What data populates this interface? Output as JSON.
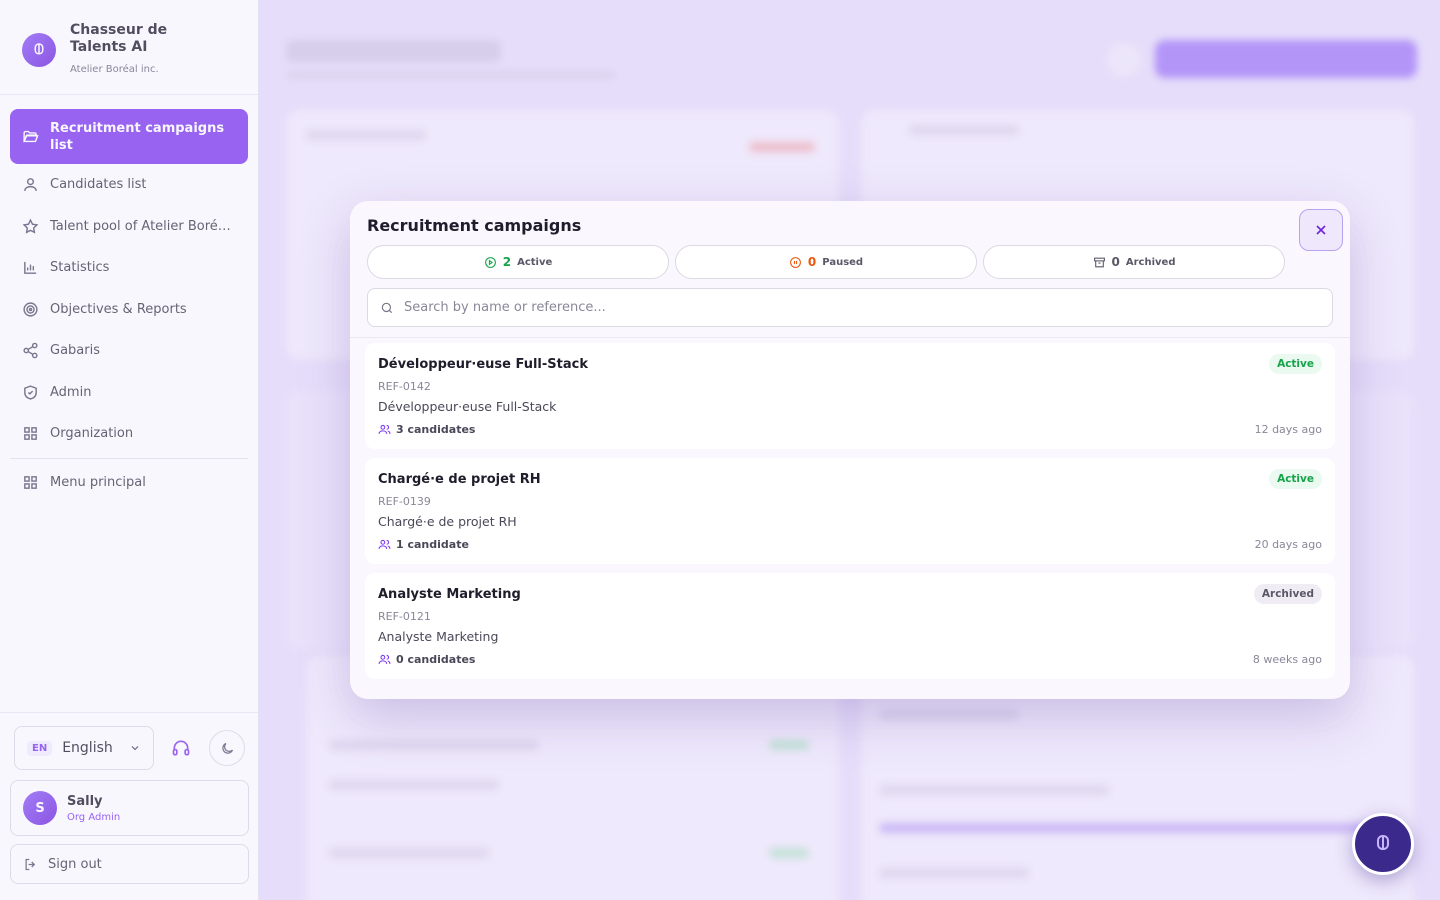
{
  "brand": {
    "title": "Chasseur de Talents AI",
    "subtitle": "Atelier Boréal inc."
  },
  "nav": {
    "items": [
      {
        "label": "Recruitment campaigns list",
        "icon": "folder-open-icon",
        "active": true
      },
      {
        "label": "Candidates list",
        "icon": "user-icon"
      },
      {
        "label": "Talent pool of Atelier Boré…",
        "icon": "star-icon"
      },
      {
        "label": "Statistics",
        "icon": "bar-chart-icon"
      },
      {
        "label": "Objectives & Reports",
        "icon": "target-icon"
      },
      {
        "label": "Gabaris",
        "icon": "share-icon"
      },
      {
        "label": "Admin",
        "icon": "shield-icon"
      },
      {
        "label": "Organization",
        "icon": "grid-icon"
      }
    ],
    "secondary": {
      "label": "Menu principal",
      "icon": "grid-icon"
    }
  },
  "language": {
    "code": "EN",
    "label": "English"
  },
  "user": {
    "initial": "S",
    "name": "Sally",
    "role": "Org Admin"
  },
  "signout_label": "Sign out",
  "modal": {
    "title": "Recruitment campaigns",
    "tabs": [
      {
        "count": "2",
        "label": "Active",
        "color": "#16a34a"
      },
      {
        "count": "0",
        "label": "Paused",
        "color": "#ea580c"
      },
      {
        "count": "0",
        "label": "Archived",
        "color": "#5a5868"
      }
    ],
    "search_placeholder": "Search by name or reference...",
    "campaigns": [
      {
        "title": "Développeur·euse Full-Stack",
        "ref": "REF-0142",
        "description": "Développeur·euse Full-Stack",
        "candidates": "3 candidates",
        "time": "12 days ago",
        "status": "Active"
      },
      {
        "title": "Chargé·e de projet RH",
        "ref": "REF-0139",
        "description": "Chargé·e de projet RH",
        "candidates": "1 candidate",
        "time": "20 days ago",
        "status": "Active"
      },
      {
        "title": "Analyste Marketing",
        "ref": "REF-0121",
        "description": "Analyste Marketing",
        "candidates": "0 candidates",
        "time": "8 weeks ago",
        "status": "Archived"
      }
    ]
  },
  "colors": {
    "accent": "#7c3aed",
    "active": "#16a34a",
    "paused": "#ea580c"
  }
}
